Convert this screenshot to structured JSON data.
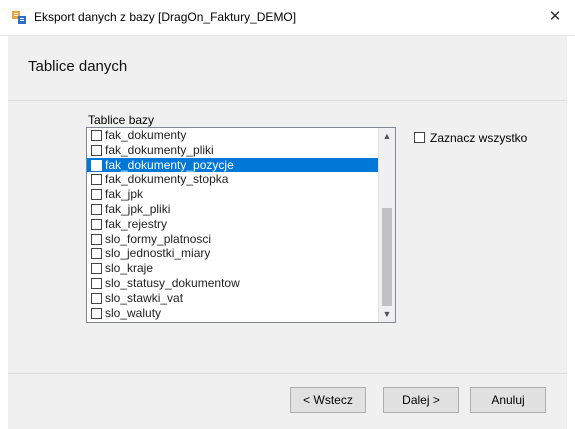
{
  "window": {
    "title": "Eksport danych z bazy [DragOn_Faktury_DEMO]",
    "close_glyph": "✕"
  },
  "header": {
    "title": "Tablice danych"
  },
  "tables_group": {
    "label": "Tablice bazy",
    "items": [
      {
        "label": "fak_dokumenty",
        "checked": false,
        "selected": false
      },
      {
        "label": "fak_dokumenty_pliki",
        "checked": false,
        "selected": false
      },
      {
        "label": "fak_dokumenty_pozycje",
        "checked": false,
        "selected": true
      },
      {
        "label": "fak_dokumenty_stopka",
        "checked": false,
        "selected": false
      },
      {
        "label": "fak_jpk",
        "checked": false,
        "selected": false
      },
      {
        "label": "fak_jpk_pliki",
        "checked": false,
        "selected": false
      },
      {
        "label": "fak_rejestry",
        "checked": false,
        "selected": false
      },
      {
        "label": "slo_formy_platnosci",
        "checked": false,
        "selected": false
      },
      {
        "label": "slo_jednostki_miary",
        "checked": false,
        "selected": false
      },
      {
        "label": "slo_kraje",
        "checked": false,
        "selected": false
      },
      {
        "label": "slo_statusy_dokumentow",
        "checked": false,
        "selected": false
      },
      {
        "label": "slo_stawki_vat",
        "checked": false,
        "selected": false
      },
      {
        "label": "slo_waluty",
        "checked": false,
        "selected": false
      }
    ],
    "scroll_up_glyph": "▲",
    "scroll_down_glyph": "▼"
  },
  "select_all": {
    "label": "Zaznacz wszystko",
    "checked": false
  },
  "buttons": {
    "back": "< Wstecz",
    "next": "Dalej >",
    "cancel": "Anuluj"
  },
  "colors": {
    "selection": "#0078d7",
    "panel": "#f0f0f0",
    "button": "#e1e1e1"
  },
  "icons": {
    "app": "database-export-icon"
  }
}
